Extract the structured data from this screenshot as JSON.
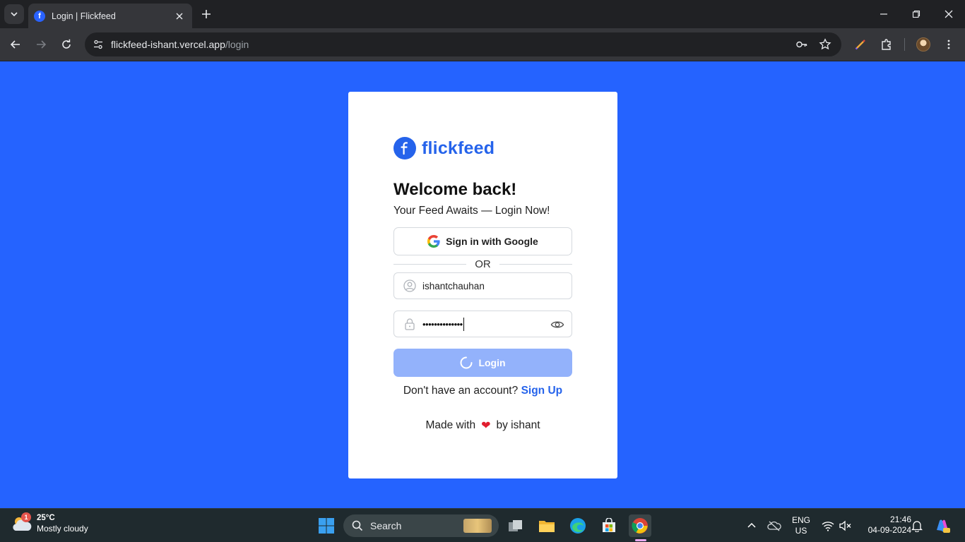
{
  "browser": {
    "tab_title": "Login | Flickfeed",
    "tab_favicon_letter": "f",
    "url_host": "flickfeed-ishant.vercel.app",
    "url_path": "/login"
  },
  "page": {
    "brand_name": "flickfeed",
    "brand_logo_letter": "f",
    "heading": "Welcome back!",
    "subtitle": "Your Feed Awaits — Login Now!",
    "google_button_label": "Sign in with Google",
    "divider_text": "OR",
    "username_value": "ishantchauhan",
    "password_mask": "••••••••••••••",
    "login_button_label": "Login",
    "signup_prompt": "Don't have an account?",
    "signup_link": "Sign Up",
    "footer_prefix": "Made with",
    "footer_heart": "❤",
    "footer_suffix": "by ishant",
    "colors": {
      "background": "#2563ff",
      "brand": "#2563eb",
      "login_button_loading": "#93b2fb"
    }
  },
  "taskbar": {
    "weather_temp": "25°C",
    "weather_desc": "Mostly cloudy",
    "weather_badge": "1",
    "search_label": "Search",
    "lang_line1": "ENG",
    "lang_line2": "US",
    "time": "21:46",
    "date": "04-09-2024"
  }
}
